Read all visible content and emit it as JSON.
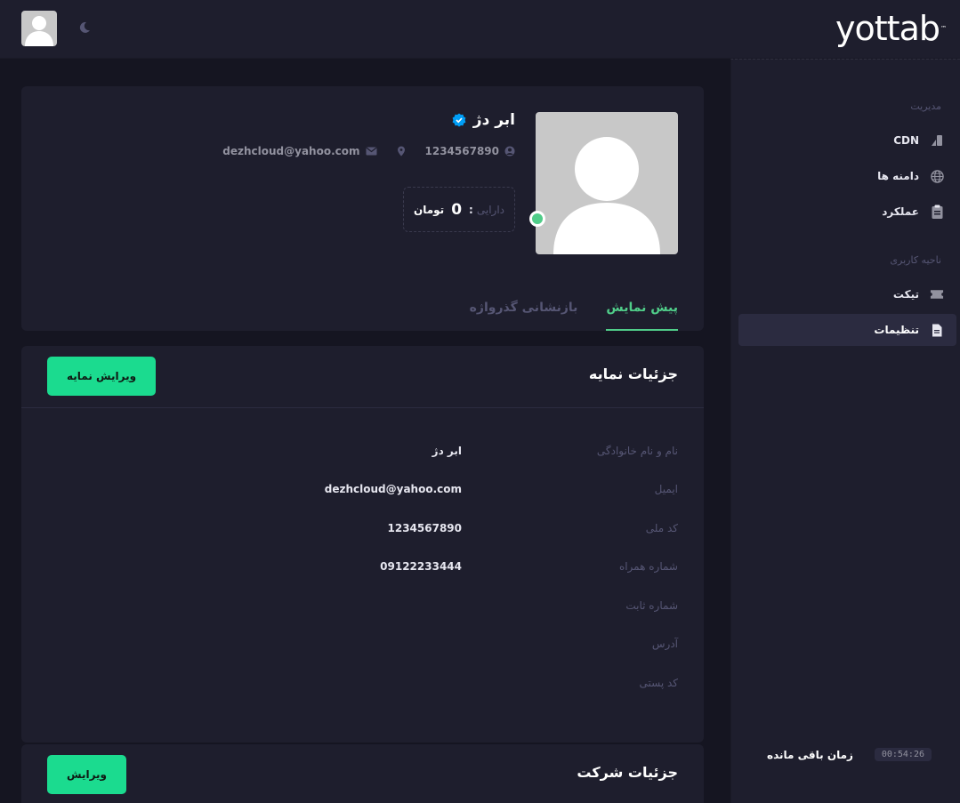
{
  "header": {
    "logo": "yottab",
    "logo_tm": "™"
  },
  "sidebar": {
    "section_management": "مدیریت",
    "management_items": [
      {
        "label": "CDN",
        "icon": "cdn-icon"
      },
      {
        "label": "دامنه ها",
        "icon": "globe-icon"
      },
      {
        "label": "عملکرد",
        "icon": "clipboard-icon"
      }
    ],
    "section_user": "ناحیه کاربری",
    "user_items": [
      {
        "label": "تیکت",
        "icon": "ticket-icon"
      },
      {
        "label": "تنظیمات",
        "icon": "document-icon",
        "active": true
      }
    ],
    "timer_label": "زمان باقی مانده",
    "timer_value": "00:54:26"
  },
  "profile": {
    "name": "ابر دژ",
    "national_code": "1234567890",
    "email": "dezhcloud@yahoo.com",
    "balance_label": "دارایی",
    "balance_colon": ":",
    "balance_value": "0",
    "balance_unit": "تومان",
    "tabs": [
      {
        "label": "پیش نمایش",
        "active": true
      },
      {
        "label": "بازنشانی گذرواژه",
        "active": false
      }
    ]
  },
  "details": {
    "title": "جزئیات نمایه",
    "edit_button": "ویرایش نمایه",
    "rows": [
      {
        "label": "نام و نام خانوادگی",
        "value": "ابر دژ"
      },
      {
        "label": "ایمیل",
        "value": "dezhcloud@yahoo.com"
      },
      {
        "label": "کد ملی",
        "value": "1234567890"
      },
      {
        "label": "شماره همراه",
        "value": "09122233444"
      },
      {
        "label": "شماره ثابت",
        "value": ""
      },
      {
        "label": "آدرس",
        "value": ""
      },
      {
        "label": "کد پستی",
        "value": ""
      }
    ]
  },
  "company": {
    "title": "جزئیات شرکت",
    "edit_button": "ویرایش"
  },
  "colors": {
    "accent_green": "#1bdb8f",
    "tab_active": "#50cd89",
    "verified_blue": "#009ef7",
    "panel": "#1e1e2d",
    "background": "#151521"
  }
}
